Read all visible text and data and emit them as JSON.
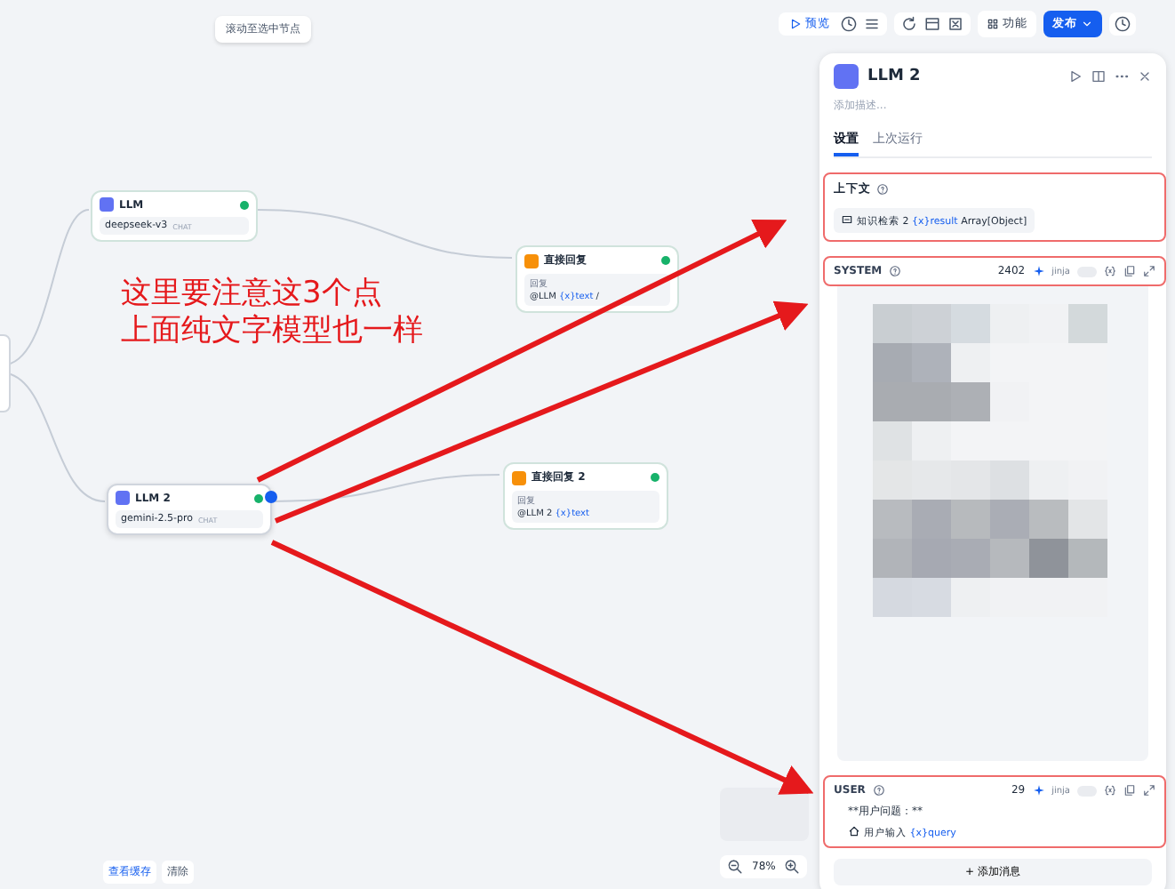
{
  "canvas_hint": "滚动至选中节点",
  "toolbar": {
    "preview": "预览",
    "features": "功能",
    "publish": "发布"
  },
  "nodes": [
    {
      "kind": "llm",
      "title": "LLM",
      "model": "deepseek-v3",
      "mode": "CHAT",
      "selected": false
    },
    {
      "kind": "answer",
      "title": "直接回复",
      "label": "回复",
      "source": "@LLM",
      "variable": "{x}text",
      "suffix": "/"
    },
    {
      "kind": "llm",
      "title": "LLM 2",
      "model": "gemini-2.5-pro",
      "mode": "CHAT",
      "selected": true
    },
    {
      "kind": "answer",
      "title": "直接回复 2",
      "label": "回复",
      "source": "@LLM 2",
      "variable": "{x}text"
    }
  ],
  "annotation": {
    "lines": [
      "这里要注意这3个点",
      "上面纯文字模型也一样"
    ]
  },
  "panel": {
    "title": "LLM 2",
    "description_placeholder": "添加描述...",
    "tabs": [
      {
        "label": "设置",
        "selected": true
      },
      {
        "label": "上次运行",
        "selected": false
      }
    ],
    "context": {
      "label": "上下文",
      "source": "知识检索 2",
      "variable": "{x}result",
      "type": "Array[Object]"
    },
    "messages": [
      {
        "role": "SYSTEM",
        "count": "2402",
        "jinja": {
          "label": "jinja",
          "on": false
        },
        "blurred": true
      },
      {
        "role": "USER",
        "count": "29",
        "jinja": {
          "label": "jinja",
          "on": false
        },
        "blurred": false,
        "text": "**用户问题：**",
        "source": "用户输入",
        "variable": "{x}query"
      }
    ],
    "add_message": "+ 添加消息"
  },
  "footer": {
    "view_cache": "查看缓存",
    "clear": "清除",
    "zoom": "78%"
  }
}
